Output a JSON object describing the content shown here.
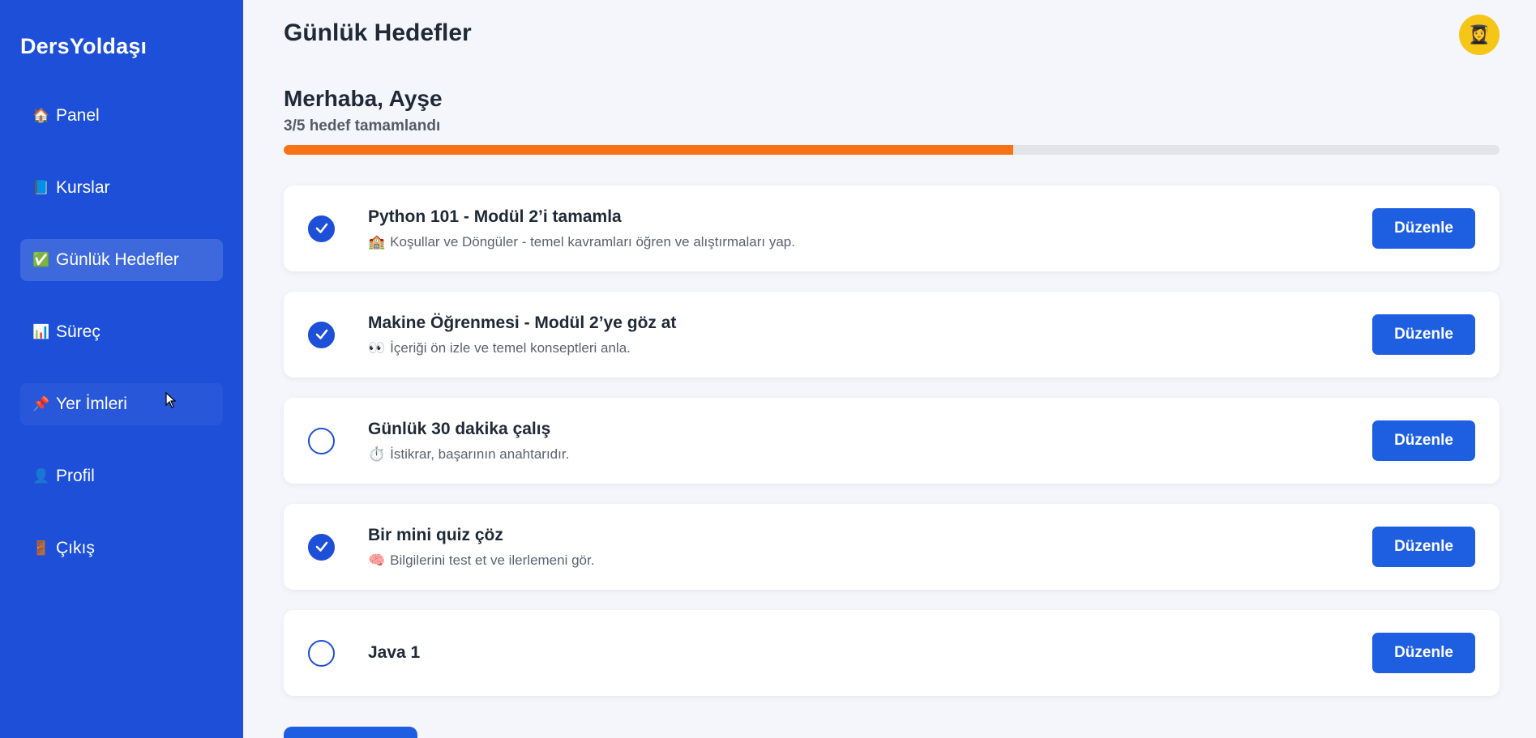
{
  "brand": "DersYoldaşı",
  "nav": [
    {
      "icon": "🏠",
      "icon_name": "home-icon",
      "label": "Panel"
    },
    {
      "icon": "📘",
      "icon_name": "book-icon",
      "label": "Kurslar"
    },
    {
      "icon": "✅",
      "icon_name": "checkmark-icon",
      "label": "Günlük Hedefler",
      "active": true
    },
    {
      "icon": "📊",
      "icon_name": "chart-icon",
      "label": "Süreç"
    },
    {
      "icon": "📌",
      "icon_name": "bookmark-icon",
      "label": "Yer İmleri",
      "hover": true
    },
    {
      "icon": "👤",
      "icon_name": "user-icon",
      "label": "Profil"
    },
    {
      "icon": "🚪",
      "icon_name": "door-icon",
      "label": "Çıkış"
    }
  ],
  "header": {
    "title": "Günlük Hedefler",
    "avatar_icon": "👩‍🎓"
  },
  "greeting": "Merhaba, Ayşe",
  "summary": "3/5 hedef tamamlandı",
  "progress": {
    "completed": 3,
    "total": 5,
    "fraction": 0.6,
    "fill_color": "#f97316"
  },
  "goals": [
    {
      "done": true,
      "title": "Python 101 - Modül 2’i tamamla",
      "desc_icon": "🏫",
      "desc": "Koşullar ve Döngüler - temel kavramları öğren ve alıştırmaları yap.",
      "button": "Düzenle"
    },
    {
      "done": true,
      "title": "Makine Öğrenmesi - Modül 2’ye göz at",
      "desc_icon": "👀",
      "desc": "İçeriği ön izle ve temel konseptleri anla.",
      "button": "Düzenle"
    },
    {
      "done": false,
      "title": "Günlük 30 dakika çalış",
      "desc_icon": "⏱️",
      "desc": "İstikrar, başarının anahtarıdır.",
      "button": "Düzenle"
    },
    {
      "done": true,
      "title": "Bir mini quiz çöz",
      "desc_icon": "🧠",
      "desc": "Bilgilerini test et ve ilerlemeni gör.",
      "button": "Düzenle"
    },
    {
      "done": false,
      "title": "Java 1",
      "desc_icon": "",
      "desc": "",
      "button": "Düzenle"
    }
  ],
  "colors": {
    "sidebar": "#1d4fd8",
    "accent": "#1d5fe0",
    "progress": "#f97316",
    "avatar": "#f5c518"
  }
}
